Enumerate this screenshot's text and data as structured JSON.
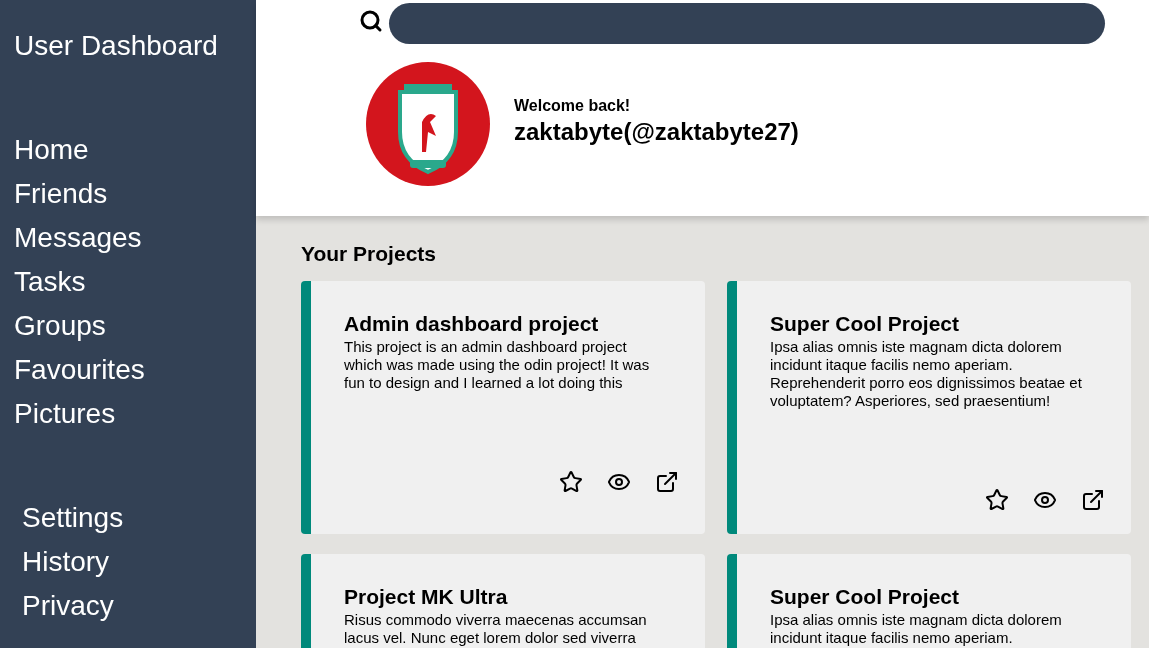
{
  "sidebar": {
    "title": "User Dashboard",
    "nav_items": [
      {
        "label": "Home"
      },
      {
        "label": "Friends"
      },
      {
        "label": "Messages"
      },
      {
        "label": "Tasks"
      },
      {
        "label": "Groups"
      },
      {
        "label": "Favourites"
      },
      {
        "label": "Pictures"
      }
    ],
    "settings_items": [
      {
        "label": "Settings"
      },
      {
        "label": "History"
      },
      {
        "label": "Privacy"
      }
    ]
  },
  "header": {
    "greeting": "Welcome back!",
    "user": "zaktabyte(@zaktabyte27)"
  },
  "projects": {
    "heading": "Your Projects",
    "cards": [
      {
        "title": "Admin dashboard project",
        "description": "This project is an admin dashboard project which was made using the odin project! It was fun to design and I learned a lot doing this"
      },
      {
        "title": "Super Cool Project",
        "description": "Ipsa alias omnis iste magnam dicta dolorem incidunt itaque facilis nemo aperiam. Reprehenderit porro eos dignissimos beatae et voluptatem? Asperiores, sed praesentium!"
      },
      {
        "title": "Project MK Ultra",
        "description": "Risus commodo viverra maecenas accumsan lacus vel. Nunc eget lorem dolor sed viverra"
      },
      {
        "title": "Super Cool Project",
        "description": "Ipsa alias omnis iste magnam dicta dolorem incidunt itaque facilis nemo aperiam."
      }
    ]
  }
}
